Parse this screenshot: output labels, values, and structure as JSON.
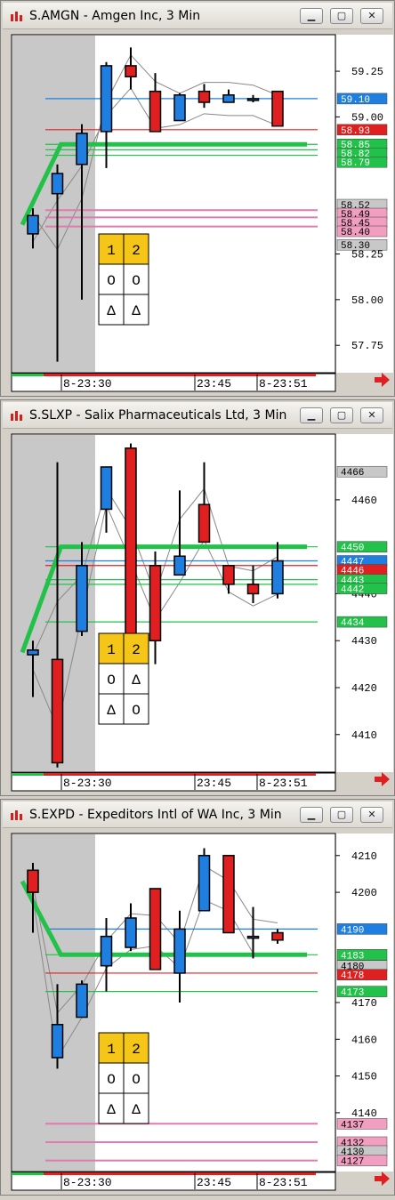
{
  "windows": [
    {
      "title": "S.AMGN - Amgen Inc, 3 Min",
      "chart_data": {
        "type": "candlestick",
        "ylim": [
          57.6,
          59.45
        ],
        "y_ticks": [
          57.75,
          58.0,
          58.25,
          59.0,
          59.25
        ],
        "y_tick_labels": [
          "57.75",
          "58.00",
          "58.25",
          "59.00",
          "59.25"
        ],
        "x_tick_labels": [
          "8-23:30",
          "23:45",
          "8-23:51"
        ],
        "candles": [
          {
            "o": 58.36,
            "h": 58.5,
            "l": 58.28,
            "c": 58.46
          },
          {
            "o": 58.58,
            "h": 58.74,
            "l": 57.66,
            "c": 58.69
          },
          {
            "o": 58.74,
            "h": 58.96,
            "l": 58.0,
            "c": 58.91
          },
          {
            "o": 58.92,
            "h": 59.3,
            "l": 58.72,
            "c": 59.28
          },
          {
            "o": 59.28,
            "h": 59.38,
            "l": 59.15,
            "c": 59.22
          },
          {
            "o": 59.14,
            "h": 59.24,
            "l": 59.0,
            "c": 58.92
          },
          {
            "o": 58.98,
            "h": 59.13,
            "l": 58.98,
            "c": 59.12
          },
          {
            "o": 59.14,
            "h": 59.18,
            "l": 59.05,
            "c": 59.08
          },
          {
            "o": 59.08,
            "h": 59.15,
            "l": 59.08,
            "c": 59.12
          },
          {
            "o": 59.1,
            "h": 59.12,
            "l": 59.08,
            "c": 59.1
          },
          {
            "o": 59.14,
            "h": 59.14,
            "l": 58.95,
            "c": 58.95
          }
        ],
        "price_tags": [
          {
            "value": 59.1,
            "label": "59.10",
            "color": "#1e7fe0"
          },
          {
            "value": 58.93,
            "label": "58.93",
            "color": "#e02020"
          },
          {
            "value": 58.85,
            "label": "58.85",
            "color": "#22c24a"
          },
          {
            "value": 58.82,
            "label": "58.82",
            "color": "#22c24a"
          },
          {
            "value": 58.79,
            "label": "58.79",
            "color": "#22c24a"
          },
          {
            "value": 58.52,
            "label": "58.52",
            "color": "#c8c8c8"
          },
          {
            "value": 58.49,
            "label": "58.49",
            "color": "#f29ec0"
          },
          {
            "value": 58.45,
            "label": "58.45",
            "color": "#f29ec0"
          },
          {
            "value": 58.4,
            "label": "58.40",
            "color": "#f29ec0"
          },
          {
            "value": 58.3,
            "label": "58.30",
            "color": "#c8c8c8"
          }
        ],
        "grid_table": [
          [
            "1",
            "2"
          ],
          [
            "O",
            "O"
          ],
          [
            "Δ",
            "Δ"
          ]
        ]
      }
    },
    {
      "title": "S.SLXP - Salix Pharmaceuticals Ltd, 3 Min",
      "chart_data": {
        "type": "candlestick",
        "ylim": [
          4402,
          4474
        ],
        "y_ticks": [
          4410,
          4420,
          4430,
          4440,
          4460
        ],
        "y_tick_labels": [
          "4410",
          "4420",
          "4430",
          "4440",
          "4460"
        ],
        "x_tick_labels": [
          "8-23:30",
          "23:45",
          "8-23:51"
        ],
        "candles": [
          {
            "o": 4427,
            "h": 4430,
            "l": 4418,
            "c": 4428
          },
          {
            "o": 4426,
            "h": 4468,
            "l": 4403,
            "c": 4404
          },
          {
            "o": 4432,
            "h": 4451,
            "l": 4431,
            "c": 4446
          },
          {
            "o": 4458,
            "h": 4466,
            "l": 4453,
            "c": 4467
          },
          {
            "o": 4471,
            "h": 4472,
            "l": 4430,
            "c": 4430
          },
          {
            "o": 4446,
            "h": 4449,
            "l": 4425,
            "c": 4430
          },
          {
            "o": 4444,
            "h": 4462,
            "l": 4444,
            "c": 4448
          },
          {
            "o": 4459,
            "h": 4468,
            "l": 4451,
            "c": 4451
          },
          {
            "o": 4446,
            "h": 4446,
            "l": 4440,
            "c": 4442
          },
          {
            "o": 4442,
            "h": 4446,
            "l": 4438,
            "c": 4440
          },
          {
            "o": 4440,
            "h": 4451,
            "l": 4439,
            "c": 4447
          }
        ],
        "price_tags": [
          {
            "value": 4466,
            "label": "4466",
            "color": "#c8c8c8"
          },
          {
            "value": 4450,
            "label": "4450",
            "color": "#22c24a"
          },
          {
            "value": 4447,
            "label": "4447",
            "color": "#1e7fe0"
          },
          {
            "value": 4446,
            "label": "4446",
            "color": "#e02020"
          },
          {
            "value": 4443,
            "label": "4443",
            "color": "#22c24a"
          },
          {
            "value": 4442,
            "label": "4442",
            "color": "#22c24a"
          },
          {
            "value": 4434,
            "label": "4434",
            "color": "#22c24a"
          }
        ],
        "grid_table": [
          [
            "1",
            "2"
          ],
          [
            "O",
            "Δ"
          ],
          [
            "Δ",
            "O"
          ]
        ]
      }
    },
    {
      "title": "S.EXPD - Expeditors Intl of WA Inc, 3 Min",
      "chart_data": {
        "type": "candlestick",
        "ylim": [
          4124,
          4216
        ],
        "y_ticks": [
          4140,
          4150,
          4160,
          4170,
          4200,
          4210
        ],
        "y_tick_labels": [
          "4140",
          "4150",
          "4160",
          "4170",
          "4200",
          "4210"
        ],
        "x_tick_labels": [
          "8-23:30",
          "23:45",
          "8-23:51"
        ],
        "candles": [
          {
            "o": 4206,
            "h": 4208,
            "l": 4189,
            "c": 4200
          },
          {
            "o": 4155,
            "h": 4175,
            "l": 4152,
            "c": 4164
          },
          {
            "o": 4166,
            "h": 4176,
            "l": 4166,
            "c": 4175
          },
          {
            "o": 4180,
            "h": 4193,
            "l": 4173,
            "c": 4188
          },
          {
            "o": 4185,
            "h": 4197,
            "l": 4184,
            "c": 4193
          },
          {
            "o": 4201,
            "h": 4201,
            "l": 4179,
            "c": 4179
          },
          {
            "o": 4178,
            "h": 4195,
            "l": 4170,
            "c": 4190
          },
          {
            "o": 4195,
            "h": 4212,
            "l": 4195,
            "c": 4210
          },
          {
            "o": 4210,
            "h": 4210,
            "l": 4189,
            "c": 4189
          },
          {
            "o": 4188,
            "h": 4196,
            "l": 4182,
            "c": 4188
          },
          {
            "o": 4189,
            "h": 4190,
            "l": 4186,
            "c": 4187
          }
        ],
        "price_tags": [
          {
            "value": 4190,
            "label": "4190",
            "color": "#1e7fe0"
          },
          {
            "value": 4183,
            "label": "4183",
            "color": "#22c24a"
          },
          {
            "value": 4180,
            "label": "4180",
            "color": "#c8c8c8"
          },
          {
            "value": 4178,
            "label": "4178",
            "color": "#e02020"
          },
          {
            "value": 4173,
            "label": "4173",
            "color": "#22c24a"
          },
          {
            "value": 4137,
            "label": "4137",
            "color": "#f29ec0"
          },
          {
            "value": 4132,
            "label": "4132",
            "color": "#f29ec0"
          },
          {
            "value": 4130,
            "label": "4130",
            "color": "#c8c8c8"
          },
          {
            "value": 4127,
            "label": "4127",
            "color": "#f29ec0"
          }
        ],
        "grid_table": [
          [
            "1",
            "2"
          ],
          [
            "O",
            "O"
          ],
          [
            "Δ",
            "Δ"
          ]
        ]
      }
    }
  ],
  "colors": {
    "up": "#1e7fe0",
    "down": "#e02020",
    "green_line": "#22c24a",
    "pink_line": "#e07ab0",
    "shade": "#c8c8c8"
  }
}
